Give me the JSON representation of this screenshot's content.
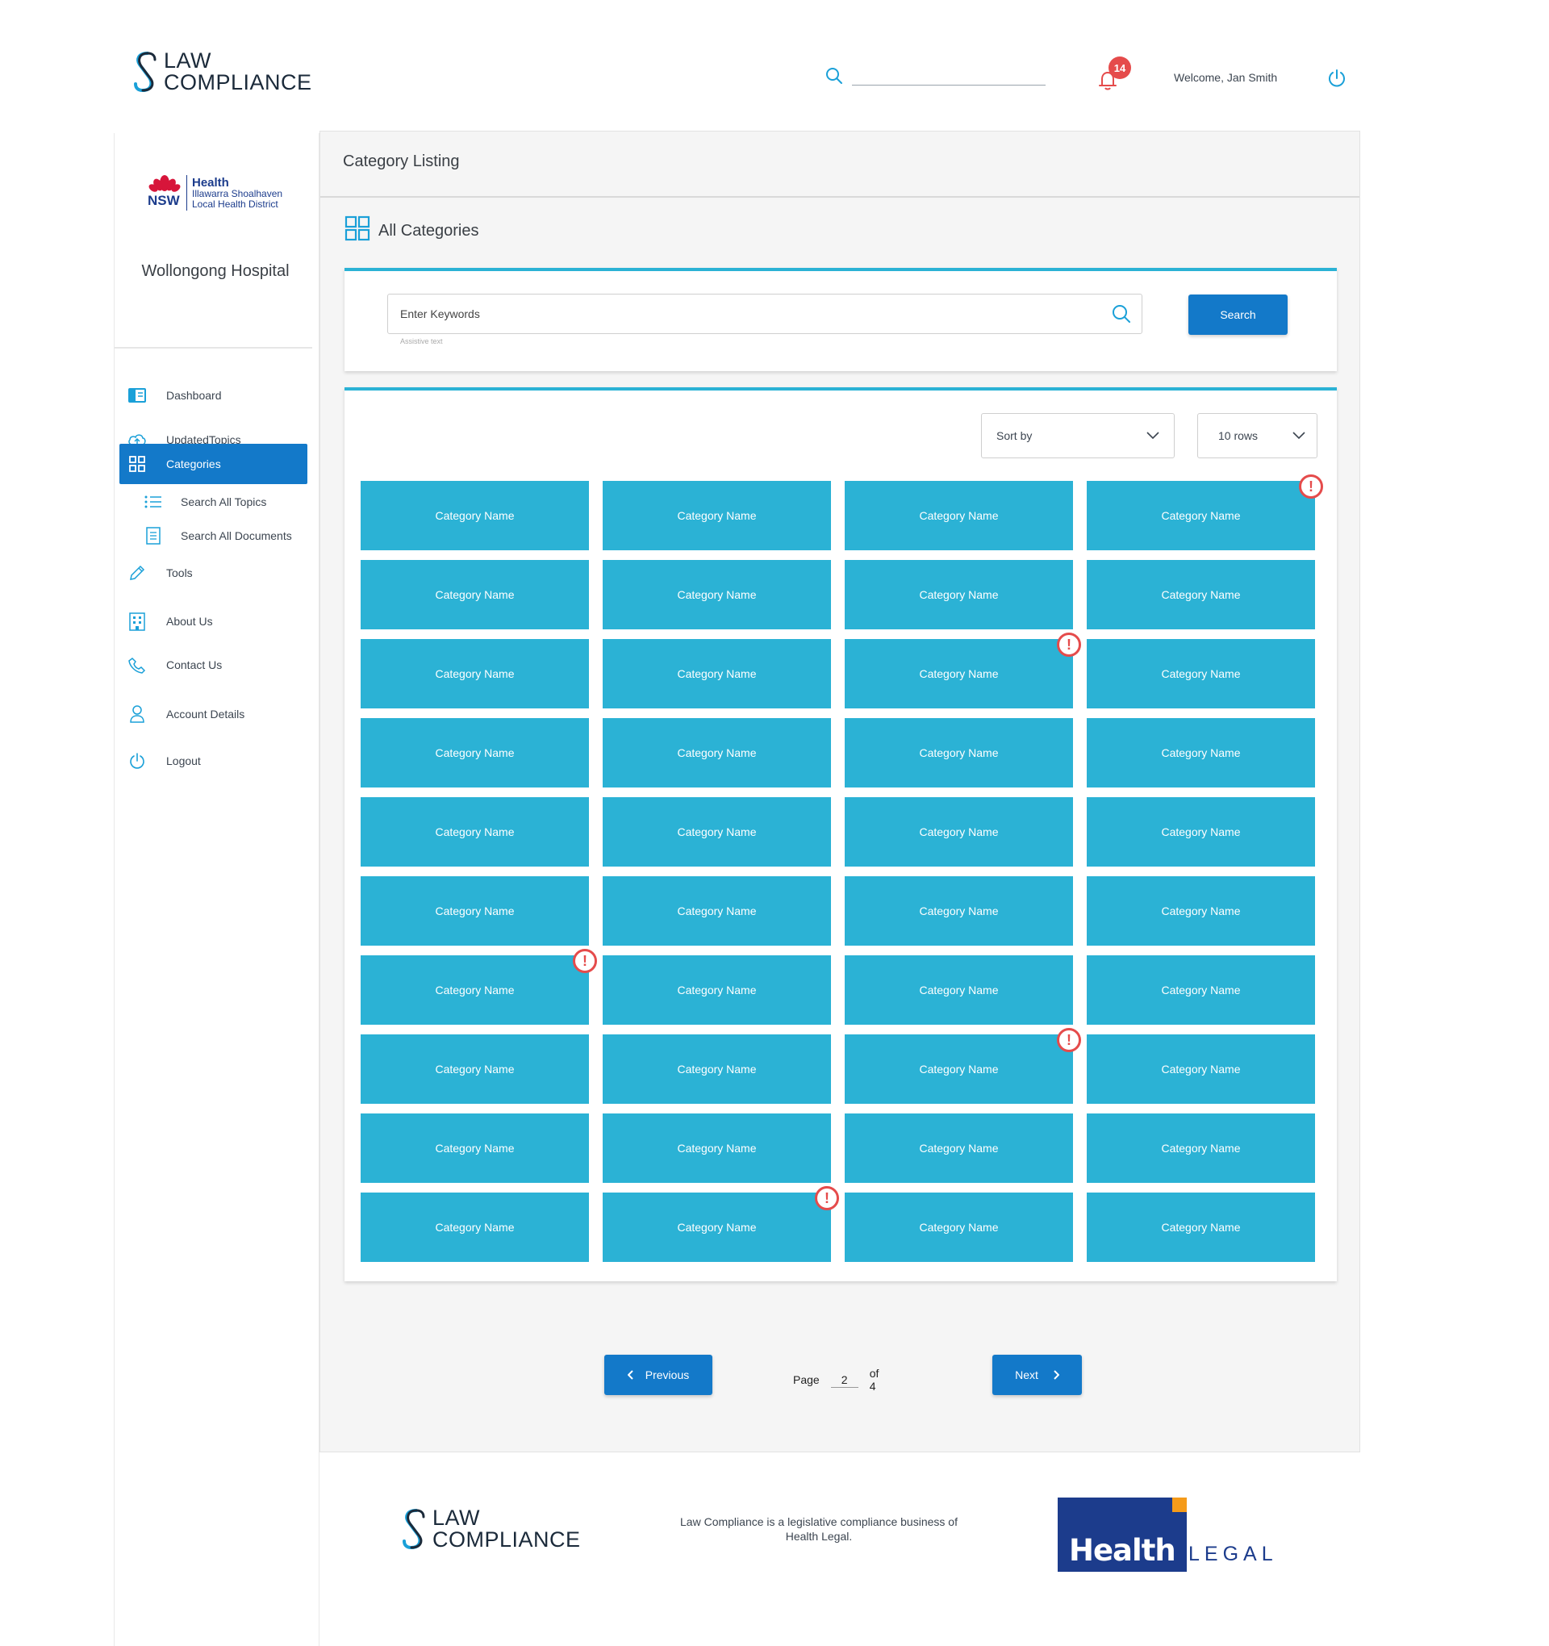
{
  "header": {
    "brand_line1": "LAW",
    "brand_line2": "COMPLIANCE",
    "notification_count": "14",
    "welcome": "Welcome, Jan Smith"
  },
  "sidebar": {
    "org_short": "NSW",
    "org_health": "Health",
    "org_line1": "Illawarra Shoalhaven",
    "org_line2": "Local Health District",
    "hospital": "Wollongong Hospital",
    "items": [
      {
        "label": "Dashboard",
        "icon": "dashboard-icon"
      },
      {
        "label": "UpdatedTopics",
        "icon": "cloud-upload-icon"
      },
      {
        "label": "Categories",
        "icon": "grid-icon",
        "active": true
      },
      {
        "label": "Search All Topics",
        "icon": "list-icon"
      },
      {
        "label": "Search All Documents",
        "icon": "document-icon"
      },
      {
        "label": "Tools",
        "icon": "pencil-icon"
      },
      {
        "label": "About Us",
        "icon": "building-icon"
      },
      {
        "label": "Contact Us",
        "icon": "phone-icon"
      },
      {
        "label": "Account Details",
        "icon": "user-icon"
      },
      {
        "label": "Logout",
        "icon": "power-icon"
      }
    ]
  },
  "main": {
    "title": "Category Listing",
    "section_title": "All Categories",
    "search": {
      "placeholder": "Enter Keywords",
      "assistive": "Assistive text",
      "button": "Search"
    },
    "sort_label": "Sort by",
    "rows_label": "10 rows",
    "tile_label": "Category Name",
    "grid": {
      "rows": 10,
      "cols": 4
    },
    "alerts": [
      [
        0,
        3
      ],
      [
        2,
        2
      ],
      [
        6,
        0
      ],
      [
        7,
        2
      ],
      [
        9,
        1
      ]
    ],
    "alert_glyph": "!"
  },
  "pagination": {
    "previous": "Previous",
    "next": "Next",
    "page_label": "Page",
    "current": "2",
    "of_label": "of 4"
  },
  "footer": {
    "brand_line1": "LAW",
    "brand_line2": "COMPLIANCE",
    "text": "Law Compliance is a legislative compliance business of Health Legal.",
    "partner_health": "Health",
    "partner_legal": "LEGAL"
  },
  "colors": {
    "accent": "#1379c9",
    "tile": "#2bb2d5",
    "alert": "#e54b4b",
    "brand_navy": "#1c3c8c"
  }
}
